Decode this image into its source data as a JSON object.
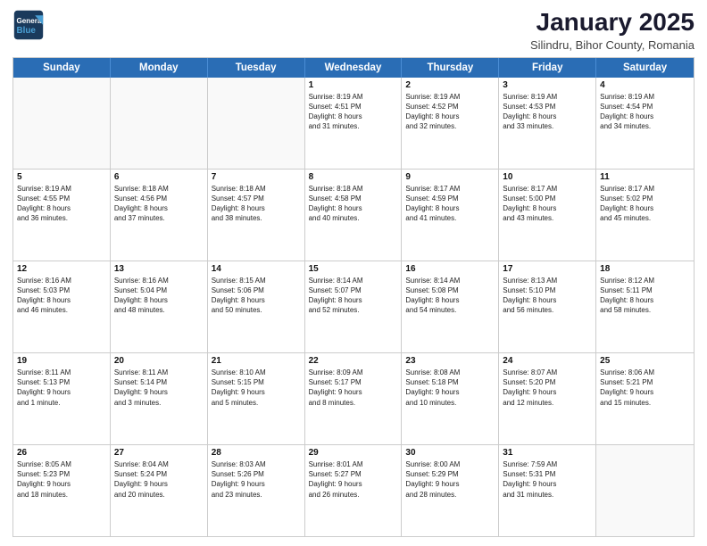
{
  "header": {
    "logo_line1": "General",
    "logo_line2": "Blue",
    "month_title": "January 2025",
    "location": "Silindru, Bihor County, Romania"
  },
  "calendar": {
    "days_of_week": [
      "Sunday",
      "Monday",
      "Tuesday",
      "Wednesday",
      "Thursday",
      "Friday",
      "Saturday"
    ],
    "weeks": [
      [
        {
          "day": "",
          "info": "",
          "empty": true
        },
        {
          "day": "",
          "info": "",
          "empty": true
        },
        {
          "day": "",
          "info": "",
          "empty": true
        },
        {
          "day": "1",
          "info": "Sunrise: 8:19 AM\nSunset: 4:51 PM\nDaylight: 8 hours\nand 31 minutes."
        },
        {
          "day": "2",
          "info": "Sunrise: 8:19 AM\nSunset: 4:52 PM\nDaylight: 8 hours\nand 32 minutes."
        },
        {
          "day": "3",
          "info": "Sunrise: 8:19 AM\nSunset: 4:53 PM\nDaylight: 8 hours\nand 33 minutes."
        },
        {
          "day": "4",
          "info": "Sunrise: 8:19 AM\nSunset: 4:54 PM\nDaylight: 8 hours\nand 34 minutes."
        }
      ],
      [
        {
          "day": "5",
          "info": "Sunrise: 8:19 AM\nSunset: 4:55 PM\nDaylight: 8 hours\nand 36 minutes."
        },
        {
          "day": "6",
          "info": "Sunrise: 8:18 AM\nSunset: 4:56 PM\nDaylight: 8 hours\nand 37 minutes."
        },
        {
          "day": "7",
          "info": "Sunrise: 8:18 AM\nSunset: 4:57 PM\nDaylight: 8 hours\nand 38 minutes."
        },
        {
          "day": "8",
          "info": "Sunrise: 8:18 AM\nSunset: 4:58 PM\nDaylight: 8 hours\nand 40 minutes."
        },
        {
          "day": "9",
          "info": "Sunrise: 8:17 AM\nSunset: 4:59 PM\nDaylight: 8 hours\nand 41 minutes."
        },
        {
          "day": "10",
          "info": "Sunrise: 8:17 AM\nSunset: 5:00 PM\nDaylight: 8 hours\nand 43 minutes."
        },
        {
          "day": "11",
          "info": "Sunrise: 8:17 AM\nSunset: 5:02 PM\nDaylight: 8 hours\nand 45 minutes."
        }
      ],
      [
        {
          "day": "12",
          "info": "Sunrise: 8:16 AM\nSunset: 5:03 PM\nDaylight: 8 hours\nand 46 minutes."
        },
        {
          "day": "13",
          "info": "Sunrise: 8:16 AM\nSunset: 5:04 PM\nDaylight: 8 hours\nand 48 minutes."
        },
        {
          "day": "14",
          "info": "Sunrise: 8:15 AM\nSunset: 5:06 PM\nDaylight: 8 hours\nand 50 minutes."
        },
        {
          "day": "15",
          "info": "Sunrise: 8:14 AM\nSunset: 5:07 PM\nDaylight: 8 hours\nand 52 minutes."
        },
        {
          "day": "16",
          "info": "Sunrise: 8:14 AM\nSunset: 5:08 PM\nDaylight: 8 hours\nand 54 minutes."
        },
        {
          "day": "17",
          "info": "Sunrise: 8:13 AM\nSunset: 5:10 PM\nDaylight: 8 hours\nand 56 minutes."
        },
        {
          "day": "18",
          "info": "Sunrise: 8:12 AM\nSunset: 5:11 PM\nDaylight: 8 hours\nand 58 minutes."
        }
      ],
      [
        {
          "day": "19",
          "info": "Sunrise: 8:11 AM\nSunset: 5:13 PM\nDaylight: 9 hours\nand 1 minute."
        },
        {
          "day": "20",
          "info": "Sunrise: 8:11 AM\nSunset: 5:14 PM\nDaylight: 9 hours\nand 3 minutes."
        },
        {
          "day": "21",
          "info": "Sunrise: 8:10 AM\nSunset: 5:15 PM\nDaylight: 9 hours\nand 5 minutes."
        },
        {
          "day": "22",
          "info": "Sunrise: 8:09 AM\nSunset: 5:17 PM\nDaylight: 9 hours\nand 8 minutes."
        },
        {
          "day": "23",
          "info": "Sunrise: 8:08 AM\nSunset: 5:18 PM\nDaylight: 9 hours\nand 10 minutes."
        },
        {
          "day": "24",
          "info": "Sunrise: 8:07 AM\nSunset: 5:20 PM\nDaylight: 9 hours\nand 12 minutes."
        },
        {
          "day": "25",
          "info": "Sunrise: 8:06 AM\nSunset: 5:21 PM\nDaylight: 9 hours\nand 15 minutes."
        }
      ],
      [
        {
          "day": "26",
          "info": "Sunrise: 8:05 AM\nSunset: 5:23 PM\nDaylight: 9 hours\nand 18 minutes."
        },
        {
          "day": "27",
          "info": "Sunrise: 8:04 AM\nSunset: 5:24 PM\nDaylight: 9 hours\nand 20 minutes."
        },
        {
          "day": "28",
          "info": "Sunrise: 8:03 AM\nSunset: 5:26 PM\nDaylight: 9 hours\nand 23 minutes."
        },
        {
          "day": "29",
          "info": "Sunrise: 8:01 AM\nSunset: 5:27 PM\nDaylight: 9 hours\nand 26 minutes."
        },
        {
          "day": "30",
          "info": "Sunrise: 8:00 AM\nSunset: 5:29 PM\nDaylight: 9 hours\nand 28 minutes."
        },
        {
          "day": "31",
          "info": "Sunrise: 7:59 AM\nSunset: 5:31 PM\nDaylight: 9 hours\nand 31 minutes."
        },
        {
          "day": "",
          "info": "",
          "empty": true
        }
      ]
    ]
  }
}
